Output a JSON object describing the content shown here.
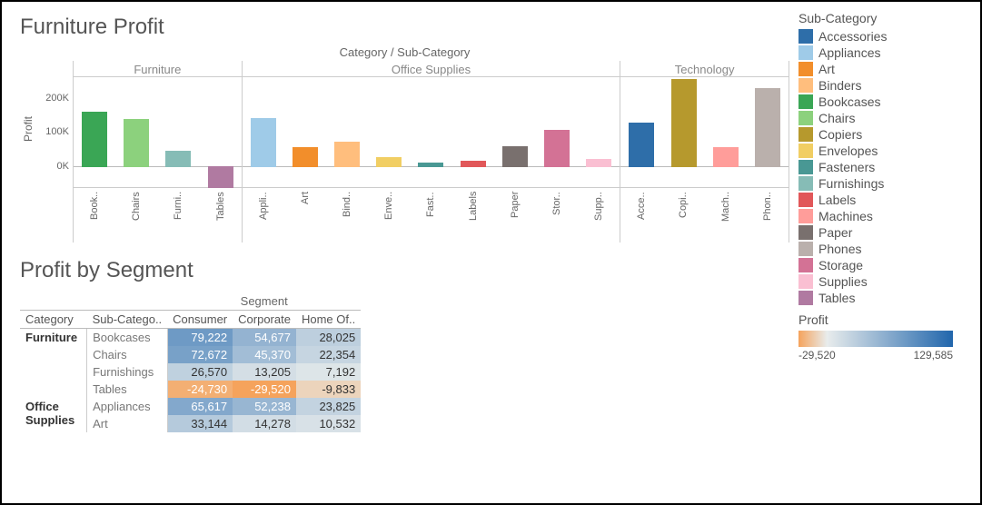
{
  "titles": {
    "chart": "Furniture Profit",
    "table": "Profit by Segment",
    "chart_super": "Category / Sub-Category",
    "ylabel": "Profit",
    "table_super": "Segment"
  },
  "yaxis": {
    "ticks": [
      "200K",
      "100K",
      "0K"
    ],
    "max": 260000,
    "min": -60000
  },
  "legend": {
    "title": "Sub-Category",
    "items": [
      {
        "name": "Accessories",
        "color": "#2E6EA9"
      },
      {
        "name": "Appliances",
        "color": "#9FCBE8"
      },
      {
        "name": "Art",
        "color": "#F28E2B"
      },
      {
        "name": "Binders",
        "color": "#FFBE7D"
      },
      {
        "name": "Bookcases",
        "color": "#3AA655"
      },
      {
        "name": "Chairs",
        "color": "#8CD17D"
      },
      {
        "name": "Copiers",
        "color": "#B6992D"
      },
      {
        "name": "Envelopes",
        "color": "#F1CE63"
      },
      {
        "name": "Fasteners",
        "color": "#499894"
      },
      {
        "name": "Furnishings",
        "color": "#86BCB6"
      },
      {
        "name": "Labels",
        "color": "#E15759"
      },
      {
        "name": "Machines",
        "color": "#FF9D9A"
      },
      {
        "name": "Paper",
        "color": "#79706E"
      },
      {
        "name": "Phones",
        "color": "#BAB0AC"
      },
      {
        "name": "Storage",
        "color": "#D37295"
      },
      {
        "name": "Supplies",
        "color": "#FABFD2"
      },
      {
        "name": "Tables",
        "color": "#B07AA1"
      }
    ],
    "gradient": {
      "title": "Profit",
      "min_label": "-29,520",
      "max_label": "129,585",
      "min": -29520,
      "max": 129585,
      "neg_color": "#F5A35C",
      "zero_color": "#E8ECEC",
      "pos_color": "#2166AC"
    }
  },
  "chart_data": {
    "type": "bar",
    "ylabel": "Profit",
    "xlabel": "Category / Sub-Category",
    "groups": [
      {
        "name": "Furniture",
        "bars": [
          {
            "label": "Book..",
            "sub": "Bookcases",
            "value": 162000
          },
          {
            "label": "Chairs",
            "sub": "Chairs",
            "value": 140000
          },
          {
            "label": "Furni..",
            "sub": "Furnishings",
            "value": 47000
          },
          {
            "label": "Tables",
            "sub": "Tables",
            "value": -64000
          }
        ]
      },
      {
        "name": "Office Supplies",
        "bars": [
          {
            "label": "Appli..",
            "sub": "Appliances",
            "value": 142000
          },
          {
            "label": "Art",
            "sub": "Art",
            "value": 58000
          },
          {
            "label": "Bind..",
            "sub": "Binders",
            "value": 73000
          },
          {
            "label": "Enve..",
            "sub": "Envelopes",
            "value": 27000
          },
          {
            "label": "Fast..",
            "sub": "Fasteners",
            "value": 12000
          },
          {
            "label": "Labels",
            "sub": "Labels",
            "value": 17000
          },
          {
            "label": "Paper",
            "sub": "Paper",
            "value": 59000
          },
          {
            "label": "Stor..",
            "sub": "Storage",
            "value": 108000
          },
          {
            "label": "Supp..",
            "sub": "Supplies",
            "value": 23000
          }
        ]
      },
      {
        "name": "Technology",
        "bars": [
          {
            "label": "Acce..",
            "sub": "Accessories",
            "value": 130000
          },
          {
            "label": "Copi..",
            "sub": "Copiers",
            "value": 258000
          },
          {
            "label": "Mach..",
            "sub": "Machines",
            "value": 58000
          },
          {
            "label": "Phon..",
            "sub": "Phones",
            "value": 230000
          }
        ]
      }
    ]
  },
  "table": {
    "col_headers": [
      "Category",
      "Sub-Catego..",
      "Consumer",
      "Corporate",
      "Home Of.."
    ],
    "rows": [
      {
        "category": "Furniture",
        "sub": "Bookcases",
        "vals": [
          79222,
          54677,
          28025
        ]
      },
      {
        "category": "",
        "sub": "Chairs",
        "vals": [
          72672,
          45370,
          22354
        ]
      },
      {
        "category": "",
        "sub": "Furnishings",
        "vals": [
          26570,
          13205,
          7192
        ]
      },
      {
        "category": "",
        "sub": "Tables",
        "vals": [
          -24730,
          -29520,
          -9833
        ]
      },
      {
        "category": "Office Supplies",
        "sub": "Appliances",
        "vals": [
          65617,
          52238,
          23825
        ]
      },
      {
        "category": "",
        "sub": "Art",
        "vals": [
          33144,
          14278,
          10532
        ]
      }
    ]
  }
}
